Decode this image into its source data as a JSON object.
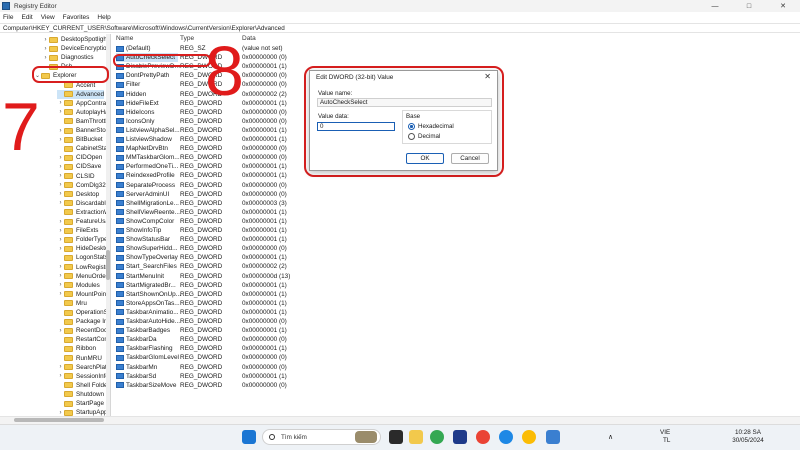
{
  "window": {
    "title": "Registry Editor",
    "minimize": "—",
    "maximize": "□",
    "close": "✕"
  },
  "menu": [
    "File",
    "Edit",
    "View",
    "Favorites",
    "Help"
  ],
  "address": "Computer\\HKEY_CURRENT_USER\\Software\\Microsoft\\Windows\\CurrentVersion\\Explorer\\Advanced",
  "tree": [
    {
      "label": "DesktopSpotligh",
      "chev": "›"
    },
    {
      "label": "DeviceEncryptio",
      "chev": "›"
    },
    {
      "label": "Diagnostics",
      "chev": "›"
    },
    {
      "label": "Dsh",
      "chev": ""
    },
    {
      "label": "Explorer",
      "chev": "⌄"
    },
    {
      "label": "Accent",
      "chev": ""
    },
    {
      "label": "Advanced",
      "chev": ""
    },
    {
      "label": "AppContract",
      "chev": "›"
    },
    {
      "label": "AutoplayHan",
      "chev": "›"
    },
    {
      "label": "BamThrottlin",
      "chev": ""
    },
    {
      "label": "BannerStore",
      "chev": "›"
    },
    {
      "label": "BitBucket",
      "chev": "›"
    },
    {
      "label": "CabinetState",
      "chev": ""
    },
    {
      "label": "CIDOpen",
      "chev": "›"
    },
    {
      "label": "CIDSave",
      "chev": "›"
    },
    {
      "label": "CLSID",
      "chev": "›"
    },
    {
      "label": "ComDlg32",
      "chev": "›"
    },
    {
      "label": "Desktop",
      "chev": "›"
    },
    {
      "label": "Discardable",
      "chev": "›"
    },
    {
      "label": "ExtractionWi",
      "chev": ""
    },
    {
      "label": "FeatureUsage",
      "chev": "›"
    },
    {
      "label": "FileExts",
      "chev": "›"
    },
    {
      "label": "FolderTypes",
      "chev": "›"
    },
    {
      "label": "HideDesktop",
      "chev": "›"
    },
    {
      "label": "LogonStats",
      "chev": ""
    },
    {
      "label": "LowRegistry",
      "chev": "›"
    },
    {
      "label": "MenuOrder",
      "chev": "›"
    },
    {
      "label": "Modules",
      "chev": "›"
    },
    {
      "label": "MountPoints2",
      "chev": "›"
    },
    {
      "label": "Mru",
      "chev": ""
    },
    {
      "label": "OperationSta",
      "chev": ""
    },
    {
      "label": "Package Insta",
      "chev": ""
    },
    {
      "label": "RecentDocs",
      "chev": "›"
    },
    {
      "label": "RestartComm",
      "chev": ""
    },
    {
      "label": "Ribbon",
      "chev": ""
    },
    {
      "label": "RunMRU",
      "chev": ""
    },
    {
      "label": "SearchPlatfor",
      "chev": "›"
    },
    {
      "label": "SessionInfo",
      "chev": "›"
    },
    {
      "label": "Shell Folders",
      "chev": ""
    },
    {
      "label": "Shutdown",
      "chev": ""
    },
    {
      "label": "StartPage",
      "chev": ""
    },
    {
      "label": "StartupAppro",
      "chev": "›"
    }
  ],
  "columns": {
    "name": "Name",
    "type": "Type",
    "data": "Data"
  },
  "rows": [
    {
      "name": "(Default)",
      "type": "REG_SZ",
      "data": "(value not set)"
    },
    {
      "name": "AutoCheckSelect",
      "type": "REG_DWORD",
      "data": "0x00000000 (0)"
    },
    {
      "name": "DisablePreviewD...",
      "type": "REG_DWORD",
      "data": "0x00000001 (1)"
    },
    {
      "name": "DontPrettyPath",
      "type": "REG_DWORD",
      "data": "0x00000000 (0)"
    },
    {
      "name": "Filter",
      "type": "REG_DWORD",
      "data": "0x00000000 (0)"
    },
    {
      "name": "Hidden",
      "type": "REG_DWORD",
      "data": "0x00000002 (2)"
    },
    {
      "name": "HideFileExt",
      "type": "REG_DWORD",
      "data": "0x00000001 (1)"
    },
    {
      "name": "HideIcons",
      "type": "REG_DWORD",
      "data": "0x00000000 (0)"
    },
    {
      "name": "IconsOnly",
      "type": "REG_DWORD",
      "data": "0x00000000 (0)"
    },
    {
      "name": "ListviewAlphaSel...",
      "type": "REG_DWORD",
      "data": "0x00000001 (1)"
    },
    {
      "name": "ListviewShadow",
      "type": "REG_DWORD",
      "data": "0x00000001 (1)"
    },
    {
      "name": "MapNetDrvBtn",
      "type": "REG_DWORD",
      "data": "0x00000000 (0)"
    },
    {
      "name": "MMTaskbarGlom...",
      "type": "REG_DWORD",
      "data": "0x00000000 (0)"
    },
    {
      "name": "PerformedOneTi...",
      "type": "REG_DWORD",
      "data": "0x00000001 (1)"
    },
    {
      "name": "ReindexedProfile",
      "type": "REG_DWORD",
      "data": "0x00000001 (1)"
    },
    {
      "name": "SeparateProcess",
      "type": "REG_DWORD",
      "data": "0x00000000 (0)"
    },
    {
      "name": "ServerAdminUI",
      "type": "REG_DWORD",
      "data": "0x00000000 (0)"
    },
    {
      "name": "ShellMigrationLe...",
      "type": "REG_DWORD",
      "data": "0x00000003 (3)"
    },
    {
      "name": "ShellViewReente...",
      "type": "REG_DWORD",
      "data": "0x00000001 (1)"
    },
    {
      "name": "ShowCompColor",
      "type": "REG_DWORD",
      "data": "0x00000001 (1)"
    },
    {
      "name": "ShowInfoTip",
      "type": "REG_DWORD",
      "data": "0x00000001 (1)"
    },
    {
      "name": "ShowStatusBar",
      "type": "REG_DWORD",
      "data": "0x00000001 (1)"
    },
    {
      "name": "ShowSuperHidd...",
      "type": "REG_DWORD",
      "data": "0x00000000 (0)"
    },
    {
      "name": "ShowTypeOverlay",
      "type": "REG_DWORD",
      "data": "0x00000001 (1)"
    },
    {
      "name": "Start_SearchFiles",
      "type": "REG_DWORD",
      "data": "0x00000002 (2)"
    },
    {
      "name": "StartMenuInit",
      "type": "REG_DWORD",
      "data": "0x0000000d (13)"
    },
    {
      "name": "StartMigratedBr...",
      "type": "REG_DWORD",
      "data": "0x00000001 (1)"
    },
    {
      "name": "StartShownOnUp...",
      "type": "REG_DWORD",
      "data": "0x00000001 (1)"
    },
    {
      "name": "StoreAppsOnTas...",
      "type": "REG_DWORD",
      "data": "0x00000001 (1)"
    },
    {
      "name": "TaskbarAnimatio...",
      "type": "REG_DWORD",
      "data": "0x00000001 (1)"
    },
    {
      "name": "TaskbarAutoHide...",
      "type": "REG_DWORD",
      "data": "0x00000000 (0)"
    },
    {
      "name": "TaskbarBadges",
      "type": "REG_DWORD",
      "data": "0x00000001 (1)"
    },
    {
      "name": "TaskbarDa",
      "type": "REG_DWORD",
      "data": "0x00000000 (0)"
    },
    {
      "name": "TaskbarFlashing",
      "type": "REG_DWORD",
      "data": "0x00000001 (1)"
    },
    {
      "name": "TaskbarGlomLevel",
      "type": "REG_DWORD",
      "data": "0x00000000 (0)"
    },
    {
      "name": "TaskbarMn",
      "type": "REG_DWORD",
      "data": "0x00000000 (0)"
    },
    {
      "name": "TaskbarSd",
      "type": "REG_DWORD",
      "data": "0x00000001 (1)"
    },
    {
      "name": "TaskbarSizeMove",
      "type": "REG_DWORD",
      "data": "0x00000000 (0)"
    }
  ],
  "annotations": {
    "seven": "7",
    "eight": "8"
  },
  "dialog": {
    "title": "Edit DWORD (32-bit) Value",
    "close": "✕",
    "value_name_label": "Value name:",
    "value_name": "AutoCheckSelect",
    "value_data_label": "Value data:",
    "value_data": "0",
    "base_label": "Base",
    "hex_label": "Hexadecimal",
    "dec_label": "Decimal",
    "ok": "OK",
    "cancel": "Cancel"
  },
  "taskbar": {
    "search_placeholder": "Tìm kiếm",
    "lang_top": "VIE",
    "lang_bottom": "TL",
    "time": "10:28 SA",
    "date": "30/05/2024",
    "chevron": "∧"
  },
  "colors": {
    "annotation": "#e01b1b",
    "selection": "#cce4f7",
    "accent": "#1a5fb4"
  }
}
